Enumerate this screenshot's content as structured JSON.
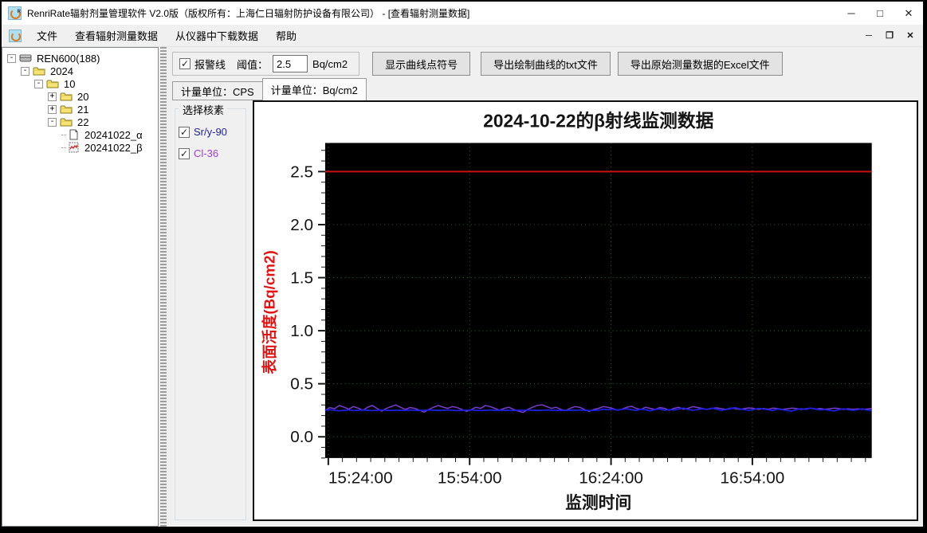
{
  "window": {
    "title": "RenriRate辐射剂量管理软件 V2.0版（版权所有：上海仁日辐射防护设备有限公司） - [查看辐射测量数据]",
    "buttons": {
      "minimize": "─",
      "maximize": "□",
      "close": "✕"
    }
  },
  "menu": {
    "items": [
      "文件",
      "查看辐射测量数据",
      "从仪器中下载数据",
      "帮助"
    ],
    "mdi": {
      "minimize": "─",
      "restore": "❐",
      "close": "✕"
    }
  },
  "tree": {
    "items": [
      {
        "label": "REN600(188)",
        "level": 0,
        "expander": "minus",
        "icon": "device"
      },
      {
        "label": "2024",
        "level": 1,
        "expander": "minus",
        "icon": "folder"
      },
      {
        "label": "10",
        "level": 2,
        "expander": "minus",
        "icon": "folder"
      },
      {
        "label": "20",
        "level": 3,
        "expander": "plus",
        "icon": "folder"
      },
      {
        "label": "21",
        "level": 3,
        "expander": "plus",
        "icon": "folder"
      },
      {
        "label": "22",
        "level": 3,
        "expander": "minus",
        "icon": "folder"
      },
      {
        "label": "20241022_α",
        "level": 4,
        "expander": "none",
        "icon": "doc"
      },
      {
        "label": "20241022_β",
        "level": 4,
        "expander": "none",
        "icon": "chart"
      }
    ]
  },
  "toolbar": {
    "alarm_checkbox_label": "报警线",
    "alarm_checked": true,
    "threshold_label": "阈值：",
    "threshold_value": "2.5",
    "threshold_unit": "Bq/cm2",
    "show_points_button": "显示曲线点符号",
    "export_txt_button": "导出绘制曲线的txt文件",
    "export_excel_button": "导出原始测量数据的Excel文件"
  },
  "tabs": [
    {
      "label": "计量单位：CPS",
      "active": false
    },
    {
      "label": "计量单位：Bq/cm2",
      "active": true
    }
  ],
  "nuclides": {
    "title": "选择核素",
    "items": [
      {
        "label": "Sr/y-90",
        "color": "#1f1f9c",
        "checked": true
      },
      {
        "label": "Cl-36",
        "color": "#9a3fd0",
        "checked": true
      }
    ]
  },
  "chart_data": {
    "type": "line",
    "title": "2024-10-22的β射线监测数据",
    "xlabel": "监测时间",
    "ylabel": "表面活度(Bq/cm2)",
    "ylabel_color": "#e31212",
    "plot_bg": "#000000",
    "grid_color": "#2e6b2e",
    "grid": true,
    "legend_position": "none",
    "ylim": [
      -0.2,
      2.77
    ],
    "y_ticks": [
      0.0,
      0.5,
      1.0,
      1.5,
      2.0,
      2.5
    ],
    "y_tick_labels": [
      "0.0",
      "0.5",
      "1.0",
      "1.5",
      "2.0",
      "2.5"
    ],
    "y_minor_step": 0.1,
    "x_range_minutes": [
      0,
      116
    ],
    "x_tick_minutes": [
      0,
      30,
      60,
      90
    ],
    "x_tick_labels": [
      "15:24:00",
      "15:54:00",
      "16:24:00",
      "16:54:00"
    ],
    "x_minor_step_minutes": 3,
    "x_step_minutes": 1,
    "alarm_line": {
      "value": 2.5,
      "color": "#cc1111",
      "label": "报警线"
    },
    "series": [
      {
        "name": "Cl-36",
        "color": "#7a3cd0",
        "width": 1.5,
        "values": [
          0.25,
          0.275,
          0.265,
          0.295,
          0.28,
          0.26,
          0.285,
          0.27,
          0.25,
          0.278,
          0.295,
          0.268,
          0.242,
          0.268,
          0.285,
          0.3,
          0.278,
          0.258,
          0.276,
          0.268,
          0.25,
          0.232,
          0.258,
          0.278,
          0.295,
          0.28,
          0.268,
          0.285,
          0.276,
          0.258,
          0.24,
          0.258,
          0.278,
          0.268,
          0.295,
          0.285,
          0.268,
          0.25,
          0.268,
          0.278,
          0.258,
          0.242,
          0.23,
          0.258,
          0.278,
          0.295,
          0.302,
          0.285,
          0.268,
          0.278,
          0.258,
          0.248,
          0.268,
          0.285,
          0.278,
          0.258,
          0.24,
          0.258,
          0.268,
          0.285,
          0.278,
          0.268,
          0.25,
          0.26,
          0.278,
          0.288,
          0.268,
          0.258,
          0.278,
          0.268,
          0.258,
          0.276,
          0.268,
          0.25,
          0.268,
          0.278,
          0.26,
          0.268,
          0.285,
          0.276,
          0.268,
          0.258,
          0.266,
          0.274,
          0.266,
          0.258,
          0.27,
          0.266,
          0.258,
          0.266,
          0.272,
          0.266,
          0.258,
          0.266,
          0.26,
          0.27,
          0.266,
          0.258,
          0.264,
          0.27,
          0.266,
          0.258,
          0.264,
          0.27,
          0.26,
          0.266,
          0.26,
          0.264,
          0.27,
          0.266,
          0.258,
          0.264,
          0.258,
          0.264,
          0.258,
          0.262,
          0.266
        ]
      },
      {
        "name": "Sr/y-90",
        "color": "#1e1ee0",
        "width": 1.8,
        "values": [
          0.25,
          0.255,
          0.25,
          0.245,
          0.25,
          0.252,
          0.248,
          0.25,
          0.253,
          0.25,
          0.247,
          0.25,
          0.252,
          0.25,
          0.248,
          0.251,
          0.25,
          0.249,
          0.252,
          0.25,
          0.248,
          0.25,
          0.253,
          0.251,
          0.249,
          0.25,
          0.252,
          0.25,
          0.247,
          0.25,
          0.251,
          0.253,
          0.25,
          0.248,
          0.25,
          0.252,
          0.249,
          0.25,
          0.251,
          0.25,
          0.248,
          0.251,
          0.25,
          0.252,
          0.25,
          0.249,
          0.25,
          0.252,
          0.251,
          0.25,
          0.249,
          0.25,
          0.251,
          0.25,
          0.252,
          0.25,
          0.248,
          0.25,
          0.251,
          0.26,
          0.255,
          0.26,
          0.252,
          0.258,
          0.265,
          0.255,
          0.248,
          0.26,
          0.255,
          0.245,
          0.258,
          0.263,
          0.25,
          0.256,
          0.252,
          0.262,
          0.27,
          0.258,
          0.25,
          0.256,
          0.265,
          0.258,
          0.27,
          0.262,
          0.25,
          0.257,
          0.265,
          0.275,
          0.263,
          0.255,
          0.25,
          0.258,
          0.268,
          0.262,
          0.255,
          0.248,
          0.262,
          0.256,
          0.248,
          0.242,
          0.256,
          0.265,
          0.258,
          0.27,
          0.263,
          0.252,
          0.258,
          0.25,
          0.243,
          0.255,
          0.264,
          0.257,
          0.25,
          0.257,
          0.264,
          0.252,
          0.248
        ]
      }
    ]
  }
}
